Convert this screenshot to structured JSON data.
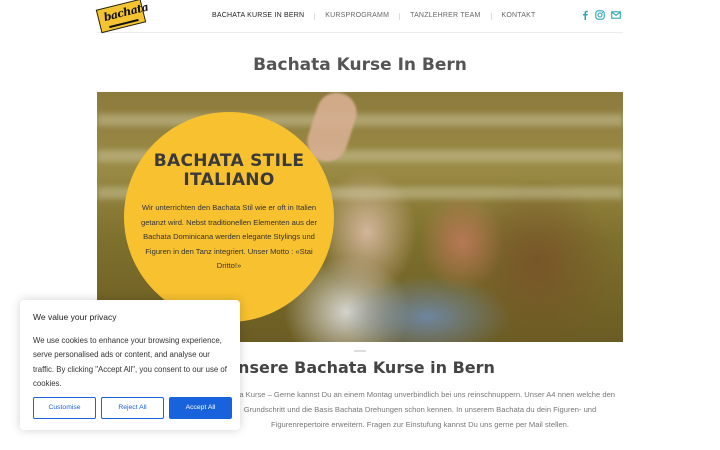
{
  "header": {
    "logo_text": "bachata",
    "nav": [
      {
        "label": "BACHATA KURSE IN BERN",
        "active": true
      },
      {
        "label": "KURSPROGRAMM",
        "active": false
      },
      {
        "label": "TANZLEHRER TEAM",
        "active": false
      },
      {
        "label": "KONTAKT",
        "active": false
      }
    ],
    "social_icons": [
      "facebook-icon",
      "instagram-icon",
      "email-icon"
    ],
    "social_color": "#2aa6b8"
  },
  "page_title": "Bachata Kurse In Bern",
  "hero": {
    "heading_line1": "BACHATA STILE",
    "heading_line2": "ITALIANO",
    "text": "Wir unterrichten den Bachata Stil wie er oft in Italien getanzt wird. Nebst traditionellen Elementen aus der Bachata Dominicana werden elegante Stylings und Figuren in den Tanz integriert. Unser Motto : «Stai Dritto!»",
    "circle_color": "#f7c12f"
  },
  "section": {
    "title": "Unsere Bachata Kurse in Bern",
    "text": "chata Kurse – Gerne kannst Du an einem Montag unverbindlich bei uns reinschnuppern. Unser A4 nnen welche den Grundschritt und die Basis Bachata Drehungen schon kennen. In unserem Bachata du dein Figuren- und Figurenrepertoire erweitern. Fragen zur Einstufung kannst Du uns gerne per Mail stellen."
  },
  "cookie": {
    "title": "We value your privacy",
    "text": "We use cookies to enhance your browsing experience, serve personalised ads or content, and analyse our traffic. By clicking \"Accept All\", you consent to our use of cookies.",
    "customise_label": "Customise",
    "reject_label": "Reject All",
    "accept_label": "Accept All",
    "accent_color": "#1863dc"
  }
}
